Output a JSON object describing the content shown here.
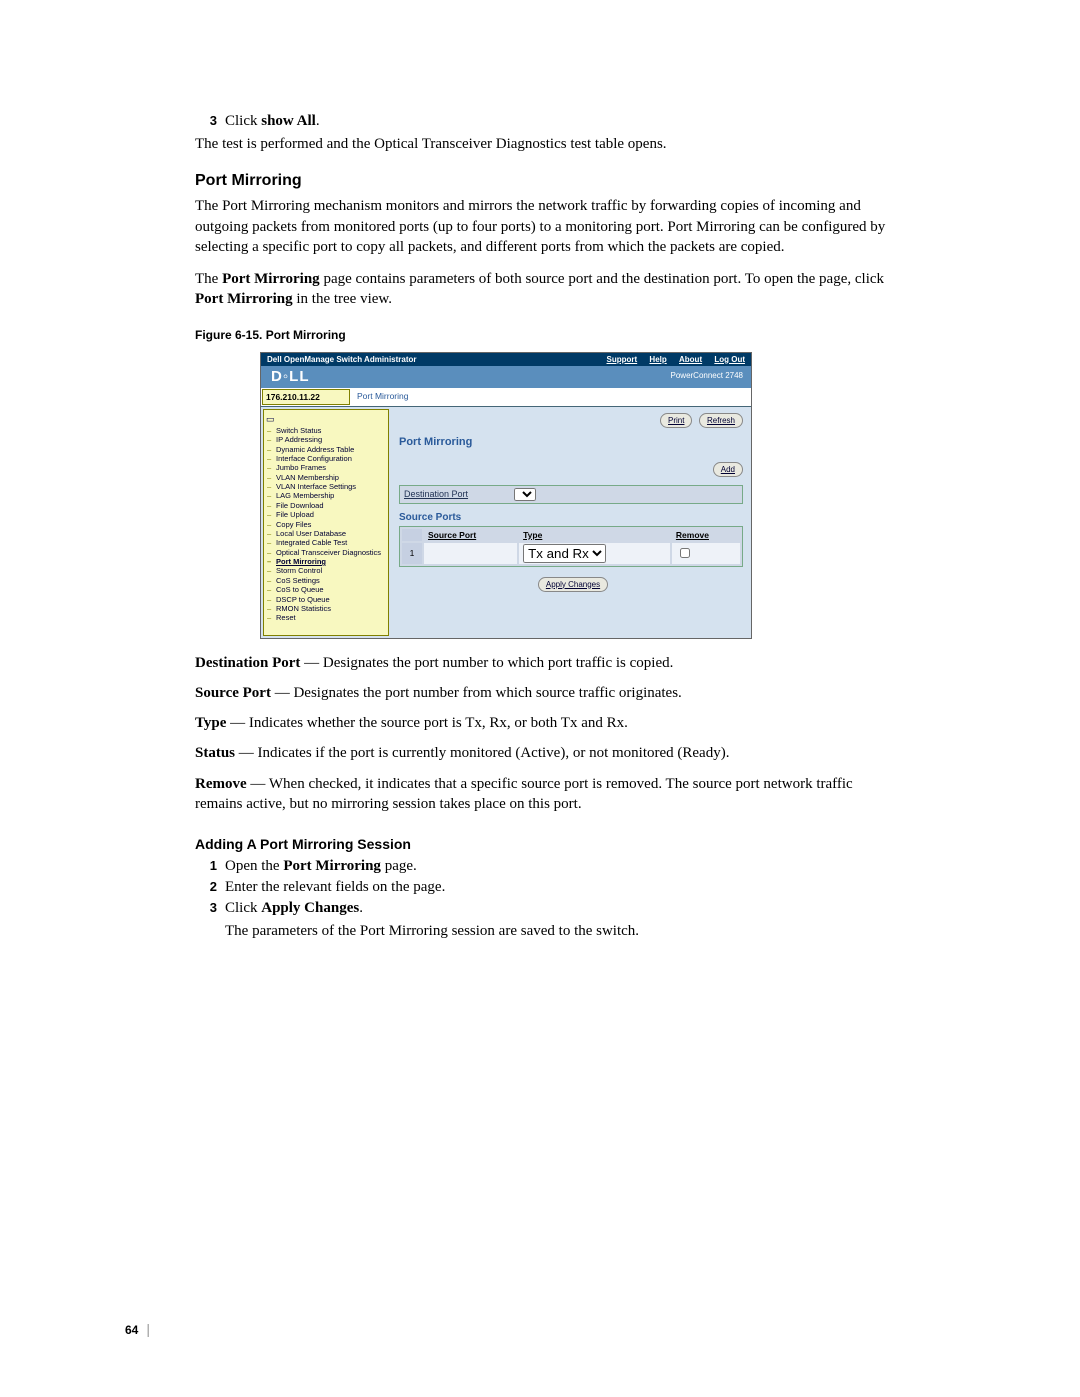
{
  "step3": {
    "num": "3",
    "pre": "Click ",
    "cmd": "show All",
    "post": "."
  },
  "after_step3": "The test is performed and the Optical Transceiver Diagnostics test table opens.",
  "section_title": "Port Mirroring",
  "pm_para1": "The Port Mirroring mechanism monitors and mirrors the network traffic by forwarding copies of incoming and outgoing packets from monitored ports (up to four ports) to a monitoring port. Port Mirroring can be configured by selecting a specific port to copy all packets, and different ports from which the packets are copied.",
  "pm_para2_a": "The ",
  "pm_para2_b": "Port Mirroring",
  "pm_para2_c": " page contains parameters of both source port and the destination port. To open the page, click ",
  "pm_para2_d": "Port Mirroring",
  "pm_para2_e": " in the tree view.",
  "figcap": "Figure 6-15.    Port Mirroring",
  "ui": {
    "top_title": "Dell OpenManage Switch Administrator",
    "links": {
      "support": "Support",
      "help": "Help",
      "about": "About",
      "logout": "Log Out"
    },
    "product": "PowerConnect 2748",
    "ip": "176.210.11.22",
    "crumb": "Port Mirroring",
    "tree": [
      "Switch Status",
      "IP Addressing",
      "Dynamic Address Table",
      "Interface Configuration",
      "Jumbo Frames",
      "VLAN Membership",
      "VLAN Interface Settings",
      "LAG Membership",
      "File Download",
      "File Upload",
      "Copy Files",
      "Local User Database",
      "Integrated Cable Test",
      "Optical Transceiver Diagnostics",
      "Port Mirroring",
      "Storm Control",
      "CoS Settings",
      "CoS to Queue",
      "DSCP to Queue",
      "RMON Statistics",
      "Reset"
    ],
    "tree_sel_index": 14,
    "main_title": "Port Mirroring",
    "btn_print": "Print",
    "btn_refresh": "Refresh",
    "btn_add": "Add",
    "dest_label": "Destination Port",
    "sp_heading": "Source Ports",
    "sp_cols": {
      "src": "Source Port",
      "type": "Type",
      "remove": "Remove"
    },
    "sp_row": {
      "idx": "1",
      "type_val": "Tx and Rx"
    },
    "apply": "Apply Changes"
  },
  "defs": {
    "dest": {
      "term": "Destination Port",
      "body": "Designates the port number to which port traffic is copied."
    },
    "src": {
      "term": "Source Port",
      "body": "Designates the port number from which source traffic originates."
    },
    "type": {
      "term": "Type",
      "body": "Indicates whether the source port is Tx, Rx, or both Tx and Rx."
    },
    "status": {
      "term": "Status",
      "body": "Indicates if the port is currently monitored (Active), or not monitored (Ready)."
    },
    "remove": {
      "term": "Remove",
      "body": "When checked, it indicates that a specific source port is removed. The source port network traffic remains active, but no mirroring session takes place on this port."
    }
  },
  "sub_title": "Adding A Port Mirroring Session",
  "steps": {
    "s1": {
      "num": "1",
      "pre": "Open the ",
      "b": "Port Mirroring",
      "post": " page."
    },
    "s2": {
      "num": "2",
      "text": "Enter the relevant fields on the page."
    },
    "s3": {
      "num": "3",
      "pre": "Click ",
      "b": "Apply Changes",
      "post": "."
    },
    "s3_after": "The parameters of the Port Mirroring session are saved to the switch."
  },
  "page_number": "64"
}
